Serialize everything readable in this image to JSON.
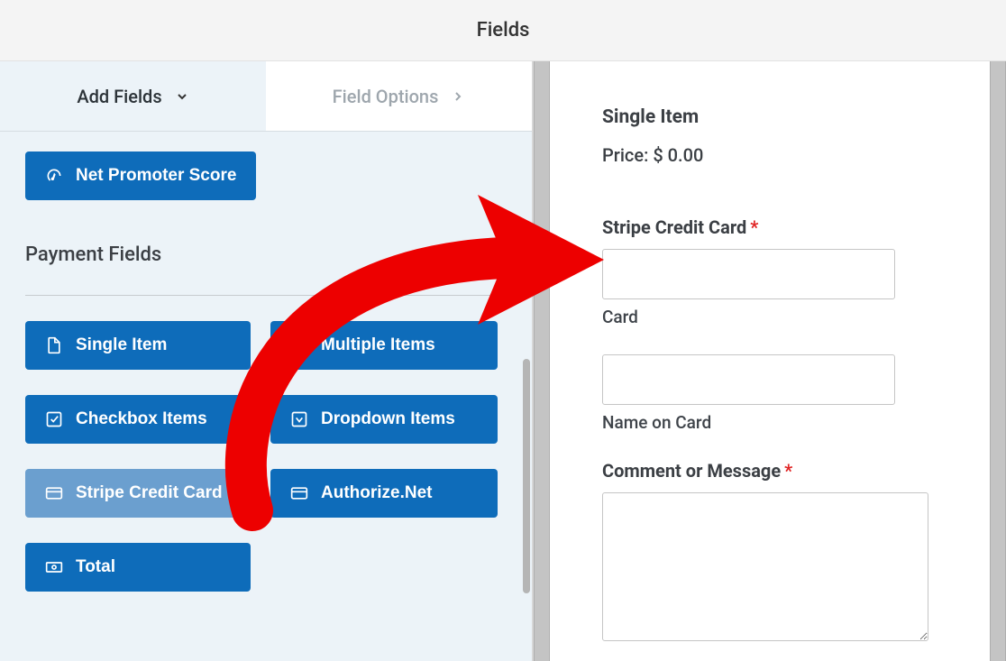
{
  "header": {
    "title": "Fields"
  },
  "tabs": {
    "add_fields": "Add Fields",
    "field_options": "Field Options"
  },
  "top_button": {
    "label": "Net Promoter Score"
  },
  "section": {
    "title": "Payment Fields"
  },
  "fields": {
    "single_item": "Single Item",
    "multiple_items": "Multiple Items",
    "checkbox_items": "Checkbox Items",
    "dropdown_items": "Dropdown Items",
    "stripe_cc": "Stripe Credit Card",
    "authorize_net": "Authorize.Net",
    "total": "Total"
  },
  "preview": {
    "item_title": "Single Item",
    "price_label": "Price: $ 0.00",
    "stripe_label": "Stripe Credit Card",
    "card_sub": "Card",
    "name_sub": "Name on Card",
    "comment_label": "Comment or Message"
  }
}
